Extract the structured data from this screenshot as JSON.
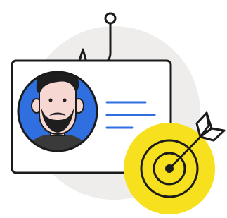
{
  "illustration": {
    "subject": "phishing-target-id-card",
    "colors": {
      "background_circle": "#eeedeb",
      "outline": "#1b1b1b",
      "card": "#ffffff",
      "avatar_bg": "#2f6fe0",
      "skin": "#f6d7d1",
      "hair": "#1e1e1e",
      "shirt": "#3a3a3a",
      "text_lines": "#2f6fe0",
      "target_fill": "#f7e01e"
    },
    "icons": [
      "fishing-hook-icon",
      "id-card-icon",
      "person-avatar-icon",
      "target-icon",
      "arrow-icon"
    ]
  }
}
